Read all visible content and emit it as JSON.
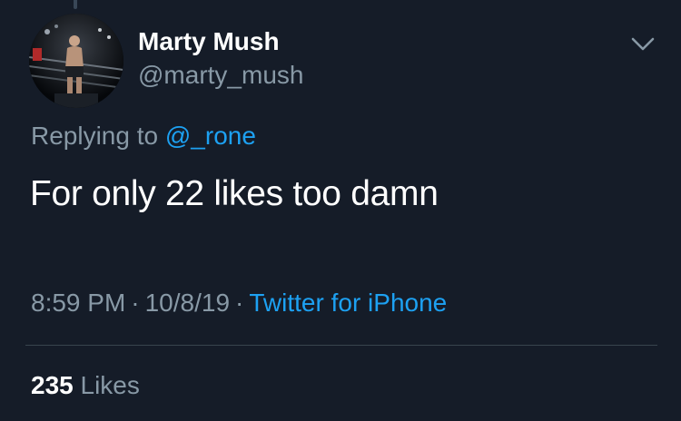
{
  "tweet": {
    "author": {
      "display_name": "Marty Mush",
      "handle": "@marty_mush",
      "avatar_icon": "boxer-in-ring-avatar"
    },
    "reply_context": {
      "prefix": "Replying to ",
      "mention": "@_rone"
    },
    "text": "For only 22 likes too damn",
    "meta": {
      "time": "8:59 PM",
      "separator": "·",
      "date": "10/8/19",
      "source": "Twitter for iPhone"
    },
    "stats": {
      "likes_count": "235",
      "likes_label": "Likes"
    },
    "menu_icon": "chevron-down-icon"
  },
  "colors": {
    "background": "#151c28",
    "primary_text": "#ffffff",
    "secondary_text": "#8899a6",
    "link": "#1da1f2",
    "divider": "#38444d"
  }
}
